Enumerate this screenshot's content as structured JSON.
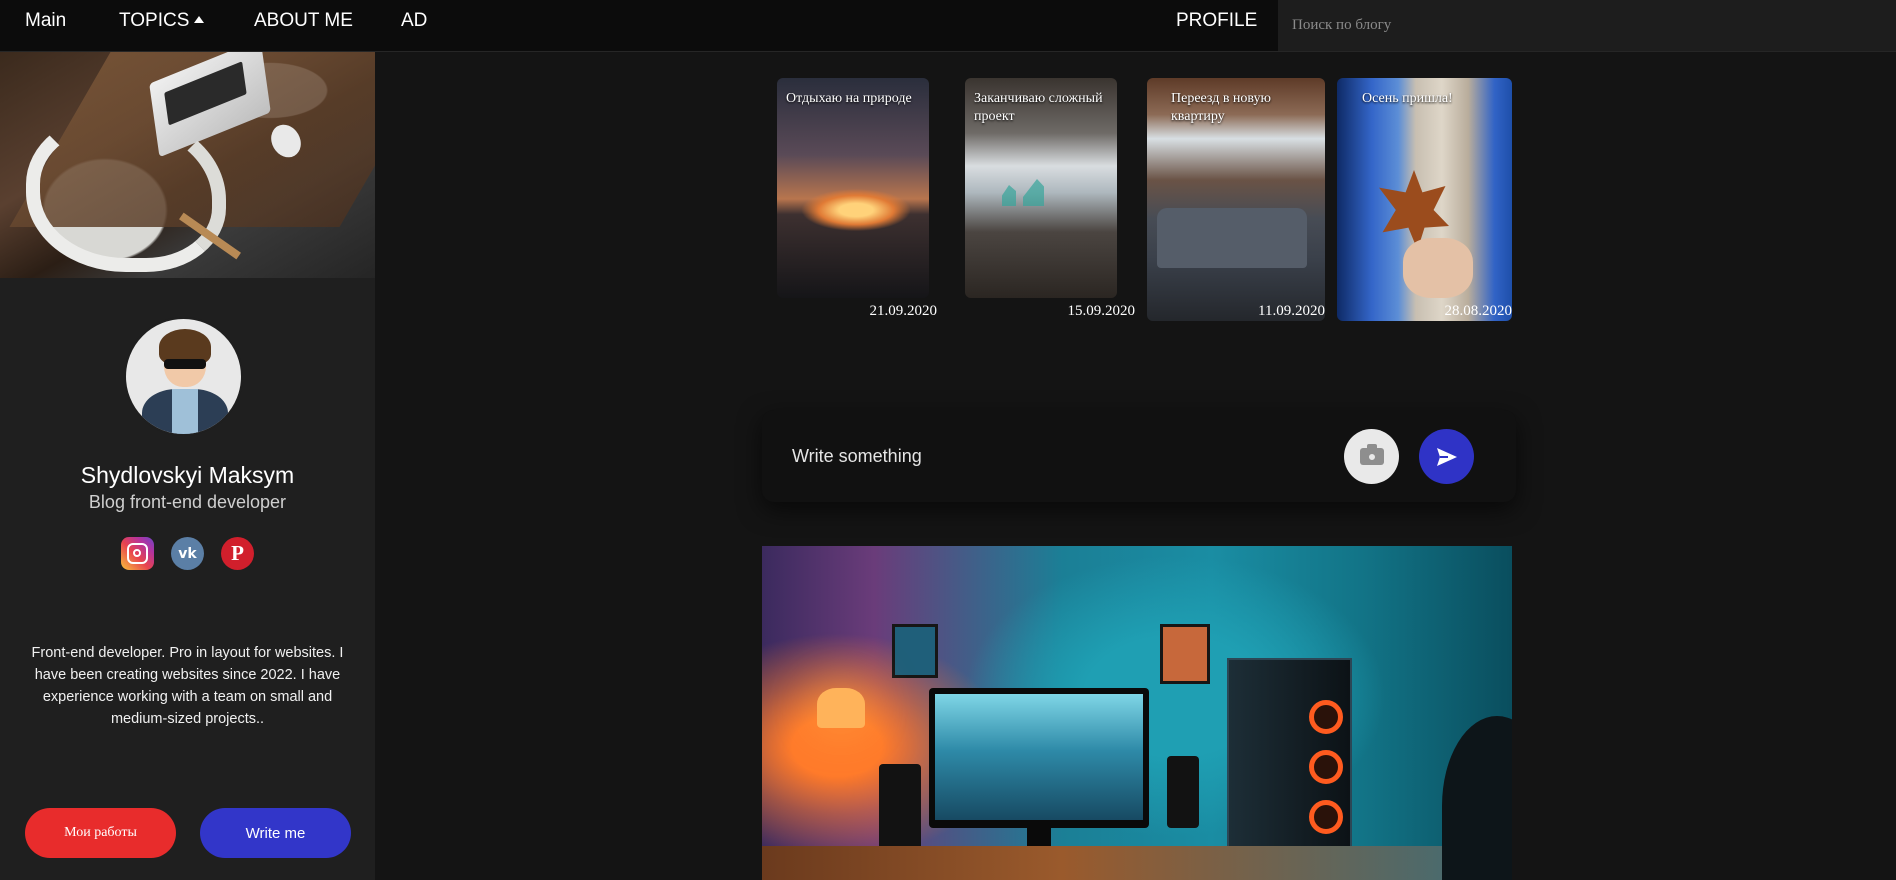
{
  "nav": {
    "main": "Main",
    "topics": "TOPICS",
    "about": "ABOUT ME",
    "ad": "AD",
    "profile": "PROFILE",
    "search_placeholder": "Поиск по блогу"
  },
  "sidebar": {
    "name": "Shydlovskyi Maksym",
    "role": "Blog front-end developer",
    "social": [
      "instagram-icon",
      "vk-icon",
      "pinterest-icon"
    ],
    "bio": "Front-end developer. Pro in layout for websites. I have been creating websites since 2022. I have experience working with a team on small and medium-sized projects..",
    "btn_works": "Мои работы",
    "btn_write": "Write me"
  },
  "stories": [
    {
      "title": "Отдыхаю на природе",
      "date": "21.09.2020"
    },
    {
      "title": "Заканчиваю сложный проект",
      "date": "15.09.2020"
    },
    {
      "title": "Переезд в новую квартиру",
      "date": "11.09.2020"
    },
    {
      "title": "Осень пришла!",
      "date": "28.08.2020"
    }
  ],
  "composer": {
    "placeholder": "Write something"
  },
  "colors": {
    "accent_blue": "#3236c9",
    "accent_red": "#e82c2c"
  }
}
